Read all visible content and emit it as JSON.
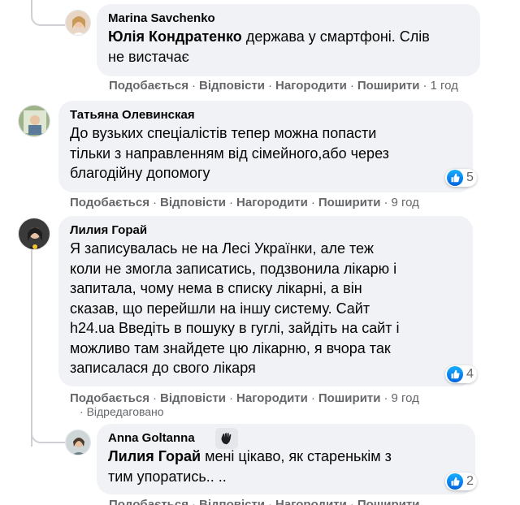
{
  "comments": [
    {
      "author": "Marina Savchenko",
      "mention": "Юлія Кондратенко",
      "line1": "держава у смартфоні. Слів",
      "line2": "не вистачає",
      "actions": [
        "Подобається",
        "Відповісти",
        "Нагородити",
        "Поширити"
      ],
      "time": "1 год"
    },
    {
      "author": "Татьяна Олевинская",
      "lines": [
        "До вузьких спеціалістів тепер можна попасти",
        "тільки з направленням від сімейного,або через",
        "благодійну допомогу"
      ],
      "reactions": "5",
      "actions": [
        "Подобається",
        "Відповісти",
        "Нагородити",
        "Поширити"
      ],
      "time": "9 год"
    },
    {
      "author": "Лилия Горай",
      "lines": [
        "Я записувалась не на Лесі Українки, але теж",
        "коли не змогла записатись, подзвонила лікарю і",
        "запитала, чому нема в списку лікарні, а він",
        "сказав, що перейшли на іншу систему. Сайт",
        "h24.ua Введіть в пошуку в гуглі, зайдіть на сайт і",
        "можливо там знайдете цю лікарню, я вчора так",
        "записалася до свого лікаря"
      ],
      "reactions": "4",
      "actions": [
        "Подобається",
        "Відповісти",
        "Нагородити",
        "Поширити"
      ],
      "time": "9 год",
      "edited": "Відредаговано"
    },
    {
      "author": "Anna Goltanna",
      "mention": "Лилия Горай",
      "line1": "мені цікаво, як старенькім з",
      "line2": "тим упоратись.. ..",
      "reactions": "2",
      "actions": [
        "Подобається",
        "Відповісти",
        "Нагородити",
        "Поширити"
      ]
    }
  ],
  "icons": {
    "like": "thumbs-up-icon",
    "wave": "waving-hand-icon"
  },
  "colors": {
    "bubble": "#f0f2f5",
    "secondary_text": "#65676b",
    "like_blue": "#1877f2"
  }
}
